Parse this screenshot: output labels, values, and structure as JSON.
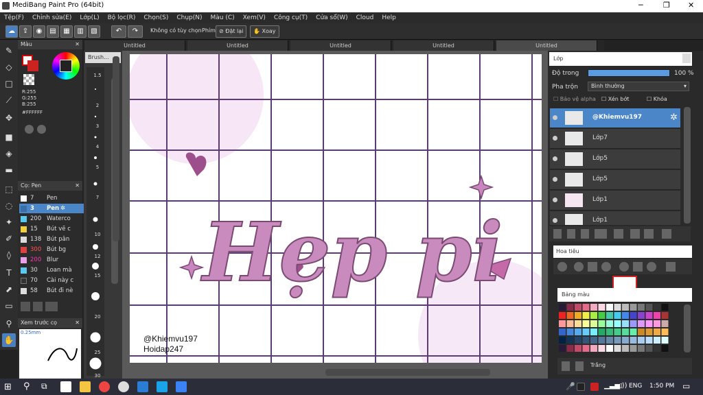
{
  "window": {
    "title": "MediBang Paint Pro (64bit)"
  },
  "menu": [
    "Tệp(F)",
    "Chỉnh sửa(E)",
    "Lớp(L)",
    "Bộ lọc(R)",
    "Chọn(S)",
    "Chụp(N)",
    "Màu (C)",
    "Xem(V)",
    "Công cụ(T)",
    "Cửa sổ(W)",
    "Cloud",
    "Help"
  ],
  "toolbar": {
    "no_options": "Không có tùy chọn",
    "shortcut_label": "Phím",
    "reset_label": "Đặt lại",
    "rotate_label": "Xoay"
  },
  "tabs": [
    "Untitled",
    "Untitled",
    "Untitled",
    "Untitled",
    "Untitled"
  ],
  "color_panel": {
    "title": "Màu",
    "r": "R:255",
    "g": "G:255",
    "b": "B:255",
    "hex": "#FFFFFF"
  },
  "brush_panel": {
    "title": "Cọ: Pen",
    "items": [
      {
        "size": "7",
        "name": "Pen",
        "color": "#ffffff"
      },
      {
        "size": "3",
        "name": "Pen",
        "color": "#3a6ea8",
        "selected": true
      },
      {
        "size": "200",
        "name": "Waterco",
        "color": "#5bc8f0"
      },
      {
        "size": "15",
        "name": "Bút vẽ c",
        "color": "#f0d040"
      },
      {
        "size": "138",
        "name": "Bút pân",
        "color": "#dddddd"
      },
      {
        "size": "300",
        "name": "Bút bg",
        "color": "#e04040"
      },
      {
        "size": "200",
        "name": "Blur",
        "color": "#e8a0e8"
      },
      {
        "size": "30",
        "name": "Loan mà",
        "color": "#5bc8f0"
      },
      {
        "size": "70",
        "name": "Cài này c",
        "color": "#333333"
      },
      {
        "size": "58",
        "name": "Bút đi nè",
        "color": "#dddddd"
      }
    ]
  },
  "preview": {
    "title": "Xem trước cọ",
    "size": "0.25mm"
  },
  "brush_sizes_title": "Brush...",
  "brush_sizes": [
    "1.5",
    "2",
    "3",
    "4",
    "5",
    "7",
    "10",
    "12",
    "15",
    "20",
    "25",
    "30"
  ],
  "canvas": {
    "watermark1": "@Khiemvu197",
    "watermark2": "Hoidap247",
    "art_text": "Hẹp pi"
  },
  "layers": {
    "title": "Lớp",
    "opacity_label": "Độ trong",
    "opacity_value": "100 %",
    "blend_label": "Pha trộn",
    "blend_value": "Bình thường",
    "protect_alpha": "Bảo vệ alpha",
    "clipping": "Xén bớt",
    "lock": "Khóa",
    "items": [
      "@Khiemvu197",
      "Lớp7",
      "Lớp5",
      "Lớp5",
      "Lớp1",
      "Lớp1"
    ]
  },
  "navigator": {
    "title": "Hoa tiêu"
  },
  "palette": {
    "title": "Bảng màu",
    "selected_name": "Trắng"
  },
  "taskbar": {
    "lang": "ENG",
    "time": "1:50 PM"
  }
}
